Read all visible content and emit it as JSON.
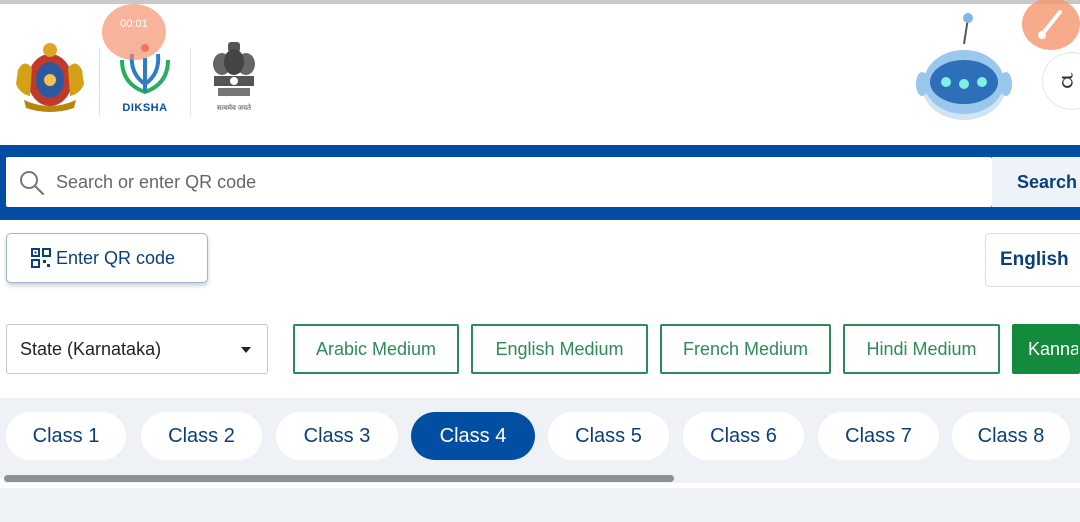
{
  "header": {
    "logos": [
      {
        "name": "karnataka-emblem-icon"
      },
      {
        "name": "diksha-logo-icon",
        "label": "DIKSHA"
      },
      {
        "name": "india-emblem-icon",
        "label": "सत्यमेव जयते"
      }
    ],
    "recording_timer": "00:01",
    "language_button_glyph": "ರ"
  },
  "search": {
    "placeholder": "Search or enter QR code",
    "button_label": "Search"
  },
  "qr_button": {
    "label": "Enter QR code"
  },
  "language_select": {
    "selected": "English"
  },
  "board_select": {
    "selected": "State (Karnataka)"
  },
  "mediums": [
    {
      "label": "Arabic Medium",
      "active": false
    },
    {
      "label": "English Medium",
      "active": false
    },
    {
      "label": "French Medium",
      "active": false
    },
    {
      "label": "Hindi Medium",
      "active": false
    },
    {
      "label": "Kannada Medium",
      "active": true
    }
  ],
  "classes": [
    {
      "label": "Class 1",
      "active": false
    },
    {
      "label": "Class 2",
      "active": false
    },
    {
      "label": "Class 3",
      "active": false
    },
    {
      "label": "Class 4",
      "active": true
    },
    {
      "label": "Class 5",
      "active": false
    },
    {
      "label": "Class 6",
      "active": false
    },
    {
      "label": "Class 7",
      "active": false
    },
    {
      "label": "Class 8",
      "active": false
    }
  ],
  "colors": {
    "primary_blue": "#024ea2",
    "medium_green": "#2e8b57",
    "active_green": "#138a3c"
  }
}
